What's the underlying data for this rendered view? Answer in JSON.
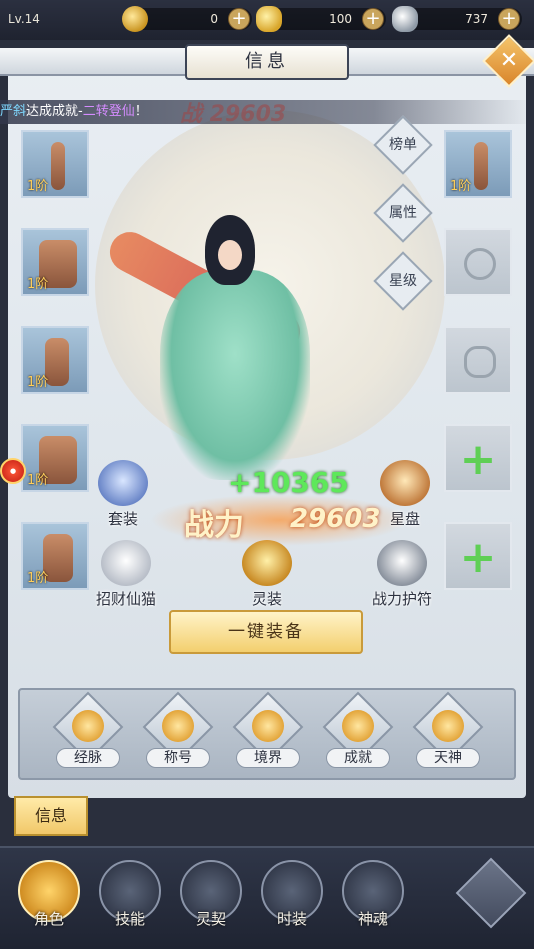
{
  "top": {
    "level": "Lv.14",
    "currencies": [
      {
        "name": "coin",
        "value": "0"
      },
      {
        "name": "gold-ingot",
        "value": "100"
      },
      {
        "name": "silver-ingot",
        "value": "737"
      }
    ]
  },
  "header": {
    "title": "信息"
  },
  "announcement": {
    "player": "严斜",
    "mid": "达成成就-",
    "achievement": "二转登仙",
    "end": "！"
  },
  "power_faint": "战 29603",
  "left_slots": [
    {
      "tier": "1阶"
    },
    {
      "tier": "1阶"
    },
    {
      "tier": "1阶"
    },
    {
      "tier": "1阶"
    },
    {
      "tier": "1阶"
    }
  ],
  "right_slots": [
    {
      "tier": "1阶"
    }
  ],
  "side_tabs": [
    "榜单",
    "属性",
    "星级"
  ],
  "functions": {
    "suit": "套装",
    "cat": "招财仙猫",
    "spirit": "灵装",
    "star": "星盘",
    "charm": "战力护符"
  },
  "power": {
    "gain": "+10365",
    "label": "战力",
    "value": "29603"
  },
  "equip_button": "一键装备",
  "tray": [
    "经脉",
    "称号",
    "境界",
    "成就",
    "天神"
  ],
  "info_tab": "信息",
  "nav": [
    "角色",
    "技能",
    "灵契",
    "时装",
    "神魂"
  ],
  "colors": {
    "accent": "#f1c869",
    "power_green": "#5ee85a",
    "tier_gold": "#ffcf5a"
  }
}
